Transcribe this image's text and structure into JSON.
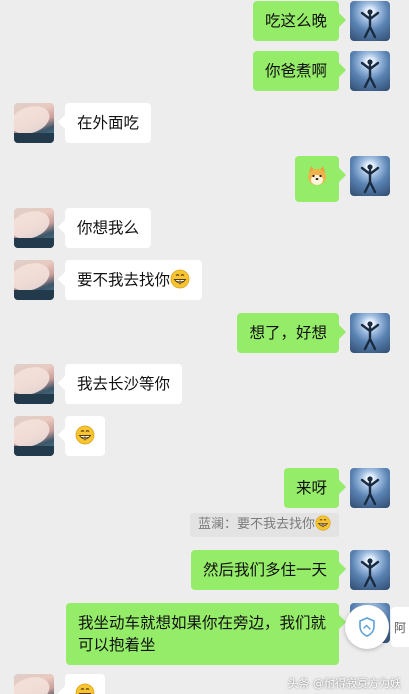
{
  "messages": [
    {
      "side": "out",
      "text": "吃这么晚"
    },
    {
      "side": "out",
      "text": "你爸煮啊"
    },
    {
      "side": "in",
      "text": "在外面吃"
    },
    {
      "side": "out",
      "sticker": "shiba-dog-sticker"
    },
    {
      "side": "in",
      "text": "你想我么"
    },
    {
      "side": "in",
      "text": "要不我去找你",
      "emoji": "grin-emoji"
    },
    {
      "side": "out",
      "text": "想了，好想"
    },
    {
      "side": "in",
      "text": "我去长沙等你"
    },
    {
      "side": "in",
      "text": "",
      "emoji": "grin-emoji"
    },
    {
      "side": "out",
      "text": "来呀"
    },
    {
      "side": "out",
      "text": "然后我们多住一天"
    },
    {
      "side": "in",
      "text": "我坐动车就想如果你在旁边，我们就可以抱着坐"
    },
    {
      "side": "in",
      "text": "",
      "emoji": "grin-emoji"
    }
  ],
  "quote": {
    "text": "蓝澜：要不我去找你",
    "emoji": "grin-emoji"
  },
  "side_tab": {
    "label": "阿"
  },
  "watermark": {
    "text": "头条 @耐得寂寞方为妖"
  },
  "colors": {
    "background": "#ededed",
    "outgoing_bubble": "#95ec69",
    "incoming_bubble": "#ffffff"
  },
  "icons": {
    "float_button": "shield-icon"
  }
}
